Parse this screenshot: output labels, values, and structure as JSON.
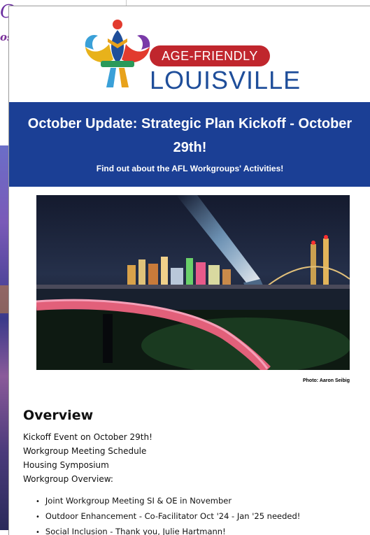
{
  "background_window": {
    "title_fragment": "Co",
    "subtitle_fragment": "os"
  },
  "email": {
    "logo": {
      "pill_text": "AGE-FRIENDLY",
      "word_text": "LOUISVILLE"
    },
    "banner": {
      "title": "October Update: Strategic Plan Kickoff - October 29th!",
      "subtitle": "Find out about the AFL Workgroups' Activities!"
    },
    "photo": {
      "credit": "Photo: Aaron Seibig"
    },
    "overview": {
      "heading": "Overview",
      "lines": [
        "Kickoff Event on October 29th!",
        "Workgroup Meeting Schedule",
        "Housing Symposium",
        "Workgroup Overview:"
      ],
      "bullets": [
        "Joint Workgroup Meeting SI & OE in November",
        "Outdoor Enhancement - Co-Facilitator Oct '24 - Jan '25 needed!",
        "Social Inclusion - Thank you, Julie Hartmann!"
      ]
    }
  }
}
